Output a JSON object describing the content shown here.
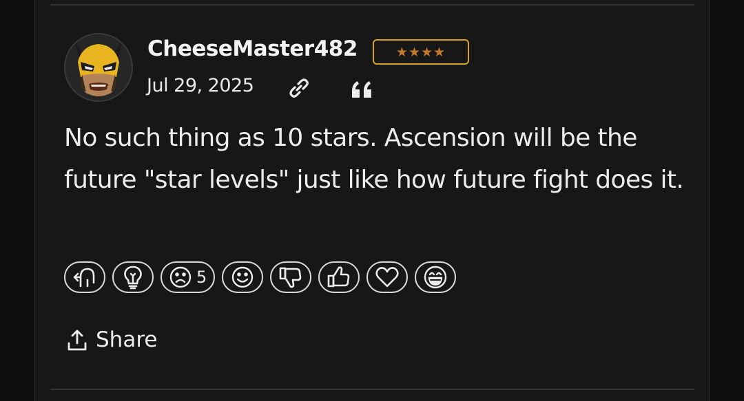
{
  "post": {
    "username": "CheeseMaster482",
    "rank_stars": "★★★★",
    "date": "Jul 29, 2025",
    "body": "No such thing as 10 stars. Ascension will be the future \"star levels\" just like how future fight does it."
  },
  "reactions": [
    {
      "icon": "reply-arrow-icon",
      "count": ""
    },
    {
      "icon": "lightbulb-icon",
      "count": ""
    },
    {
      "icon": "sad-face-icon",
      "count": "5"
    },
    {
      "icon": "smile-face-icon",
      "count": ""
    },
    {
      "icon": "thumbs-down-icon",
      "count": ""
    },
    {
      "icon": "thumbs-up-icon",
      "count": ""
    },
    {
      "icon": "heart-icon",
      "count": ""
    },
    {
      "icon": "laughing-face-icon",
      "count": ""
    }
  ],
  "share": {
    "label": "Share"
  },
  "colors": {
    "background": "#171717",
    "badge_border": "#d9a21e",
    "badge_stars": "#c47a2a",
    "text": "#ececec"
  }
}
